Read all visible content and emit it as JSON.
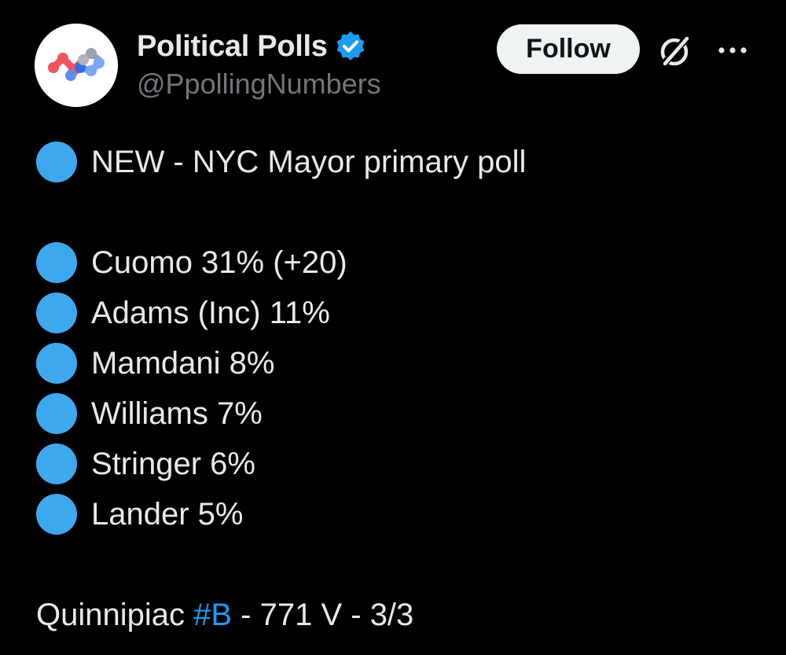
{
  "author": {
    "display_name": "Political Polls",
    "handle": "@PpollingNumbers",
    "verified": true,
    "avatar_icon": "network-logo-icon"
  },
  "actions": {
    "follow_label": "Follow",
    "grok_icon": "grok-icon",
    "more_icon": "more-icon"
  },
  "tweet": {
    "headline": "NEW - NYC Mayor primary poll",
    "results": [
      "Cuomo 31% (+20)",
      "Adams (Inc) 11%",
      "Mamdani 8%",
      "Williams 7%",
      "Stringer 6%",
      "Lander 5%"
    ],
    "footer_prefix": "Quinnipiac ",
    "footer_hashtag": "#B",
    "footer_suffix": " - 771 V - 3/3"
  },
  "colors": {
    "background": "#000000",
    "text": "#e7e9ea",
    "secondary_text": "#71767b",
    "accent": "#1d9bf0",
    "bullet": "#3ea8ef",
    "button_bg": "#eff3f4"
  }
}
